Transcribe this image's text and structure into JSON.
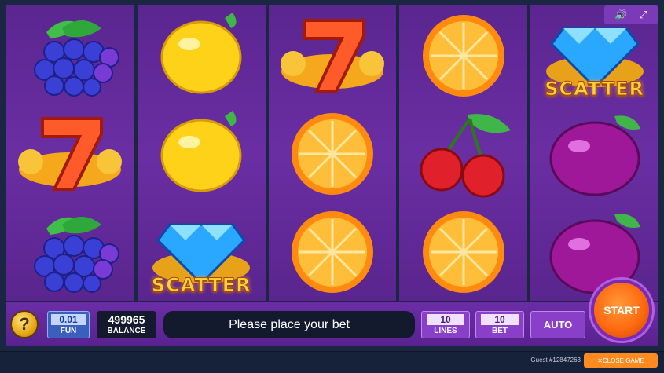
{
  "controls": {
    "help_label": "?",
    "fun_value": "0.01",
    "fun_label": "FUN",
    "balance_value": "499965",
    "balance_label": "BALANCE",
    "message": "Please place your bet",
    "lines_value": "10",
    "lines_label": "LINES",
    "bet_value": "10",
    "bet_label": "BET",
    "auto_label": "AUTO",
    "start_label": "START"
  },
  "top_controls": {
    "sound_icon": "sound-icon",
    "fullscreen_icon": "fullscreen-icon"
  },
  "footer": {
    "guest_label": "Guest #12847263",
    "close_label": "✕CLOSE GAME"
  },
  "reels": [
    [
      "grapes",
      "seven",
      "grapes"
    ],
    [
      "lemon",
      "lemon",
      "diamond-scatter"
    ],
    [
      "seven",
      "orange",
      "orange"
    ],
    [
      "orange",
      "cherries",
      "orange"
    ],
    [
      "diamond-scatter",
      "plum",
      "plum"
    ]
  ],
  "scatter_label": "SCATTER",
  "colors": {
    "reel_bg": "#6a2ea3",
    "start": "#ff6a10",
    "close": "#ff8a1f"
  }
}
